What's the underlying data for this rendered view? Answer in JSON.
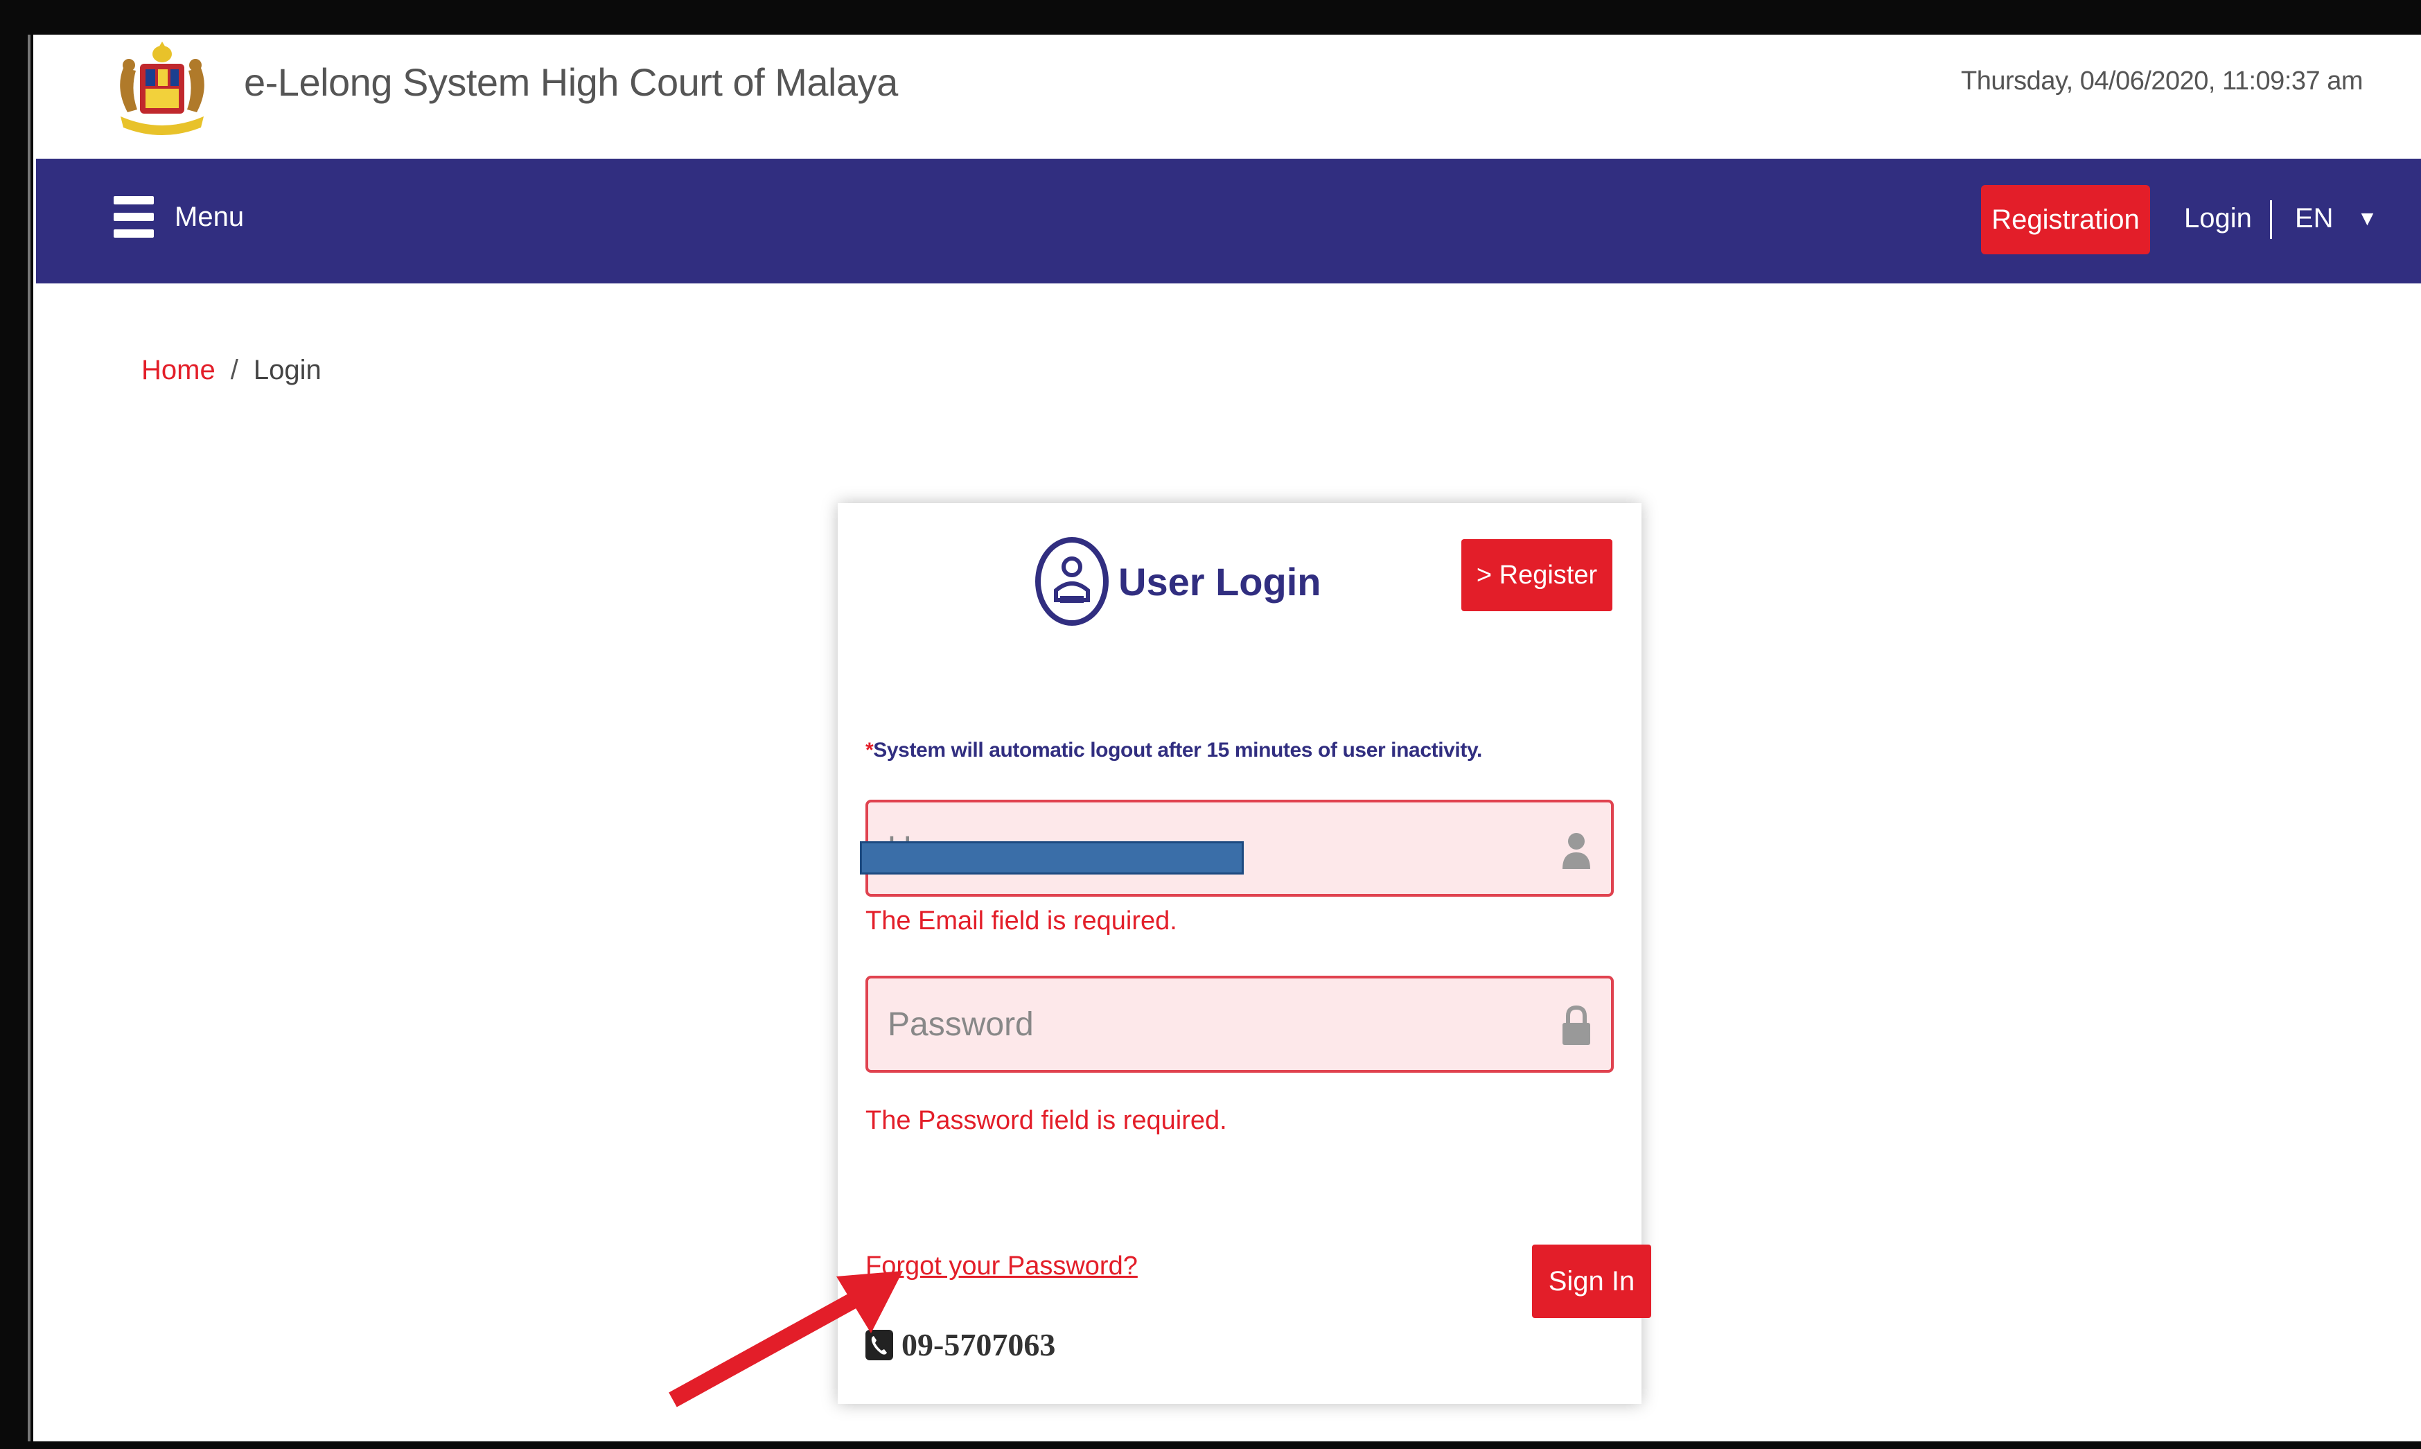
{
  "header": {
    "title": "e-Lelong System High Court of Malaya",
    "datetime": "Thursday, 04/06/2020, 11:09:37 am"
  },
  "nav": {
    "menu_label": "Menu",
    "registration_label": "Registration",
    "login_label": "Login",
    "language": "EN",
    "language_caret": "▼"
  },
  "breadcrumb": {
    "home": "Home",
    "separator": "/",
    "current": "Login"
  },
  "login_card": {
    "title": "User Login",
    "register_button": "> Register",
    "note_star": "*",
    "note": "System will automatic logout after 15 minutes of user inactivity.",
    "email_placeholder": "Username",
    "email_error": "The Email field is required.",
    "password_placeholder": "Password",
    "password_error": "The Password field is required.",
    "forgot_password": "Forgot your Password?",
    "sign_in_button": "Sign In",
    "phone": "09-5707063"
  },
  "colors": {
    "nav_bg": "#312e80",
    "accent_red": "#e31e29",
    "field_bg": "#fde8ea",
    "redaction": "#3a6ea8"
  },
  "icons": {
    "menu": "hamburger-icon",
    "crest": "malaysia-crest-icon",
    "login": "user-login-icon",
    "email": "user-icon",
    "password": "lock-icon",
    "phone": "phone-icon",
    "annotation": "red-arrow"
  }
}
